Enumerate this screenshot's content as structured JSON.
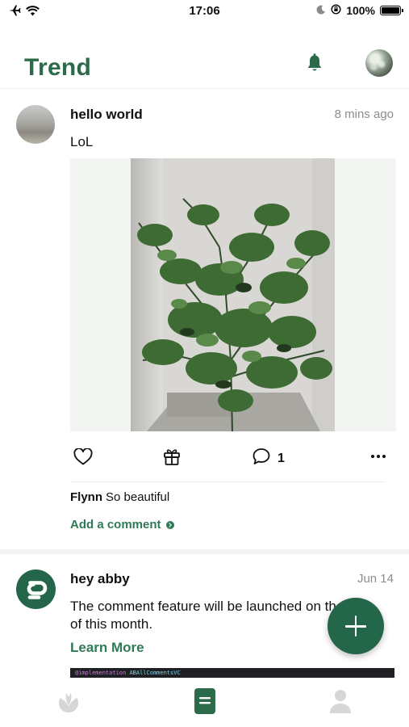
{
  "status_bar": {
    "time": "17:06",
    "battery": "100%",
    "battery_level": 1.0,
    "icons": [
      "airplane-icon",
      "wifi-icon",
      "moon-icon",
      "orientation-lock-icon",
      "battery-icon"
    ]
  },
  "header": {
    "title": "Trend",
    "title_color": "#2b6b4a",
    "icons": [
      "bell-icon",
      "profile-avatar"
    ]
  },
  "posts": [
    {
      "title": "hello world",
      "time": "8 mins ago",
      "body": "LoL",
      "comment_count": "1",
      "comments": [
        {
          "user": "Flynn",
          "text": "So beautiful"
        }
      ],
      "add_comment_label": "Add a comment",
      "action_icons": [
        "heart-icon",
        "gift-icon",
        "comment-icon",
        "more-icon"
      ]
    },
    {
      "title": "hey abby",
      "time": "Jun 14",
      "body": "The comment feature will be launched on the 29th of this month.",
      "link_label": "Learn More",
      "code_preview_keyword": "@implementation",
      "code_preview_class": "ABAllCommentsVC"
    }
  ],
  "fab": {
    "icon": "plus-icon",
    "color": "#23664a"
  },
  "tab_bar": {
    "items": [
      {
        "icon": "plant-icon",
        "active": false
      },
      {
        "icon": "document-icon",
        "active": true
      },
      {
        "icon": "person-icon",
        "active": false
      }
    ],
    "active_color": "#2b6b4a",
    "inactive_color": "#d6d6d6"
  },
  "accent_color": "#2f7a55"
}
